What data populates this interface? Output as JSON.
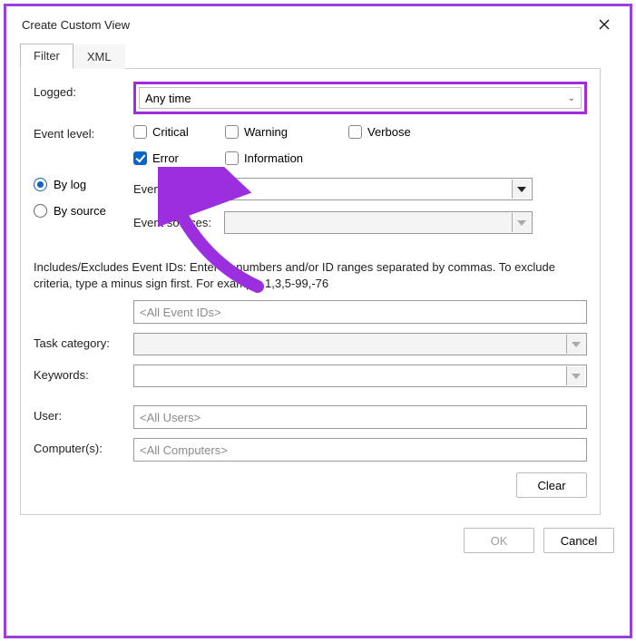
{
  "title": "Create Custom View",
  "tabs": {
    "filter": "Filter",
    "xml": "XML"
  },
  "labels": {
    "logged": "Logged:",
    "event_level": "Event level:",
    "by_log": "By log",
    "by_source": "By source",
    "event_logs": "Event logs:",
    "event_sources": "Event sources:",
    "task_category": "Task category:",
    "keywords": "Keywords:",
    "user": "User:",
    "computers": "Computer(s):"
  },
  "logged_value": "Any time",
  "levels": {
    "critical": "Critical",
    "warning": "Warning",
    "verbose": "Verbose",
    "error": "Error",
    "information": "Information"
  },
  "helptext": "Includes/Excludes Event IDs: Enter ID numbers and/or ID ranges separated by commas. To exclude criteria, type a minus sign first. For example 1,3,5-99,-76",
  "placeholders": {
    "event_ids": "<All Event IDs>",
    "users": "<All Users>",
    "computers": "<All Computers>"
  },
  "buttons": {
    "clear": "Clear",
    "ok": "OK",
    "cancel": "Cancel"
  }
}
